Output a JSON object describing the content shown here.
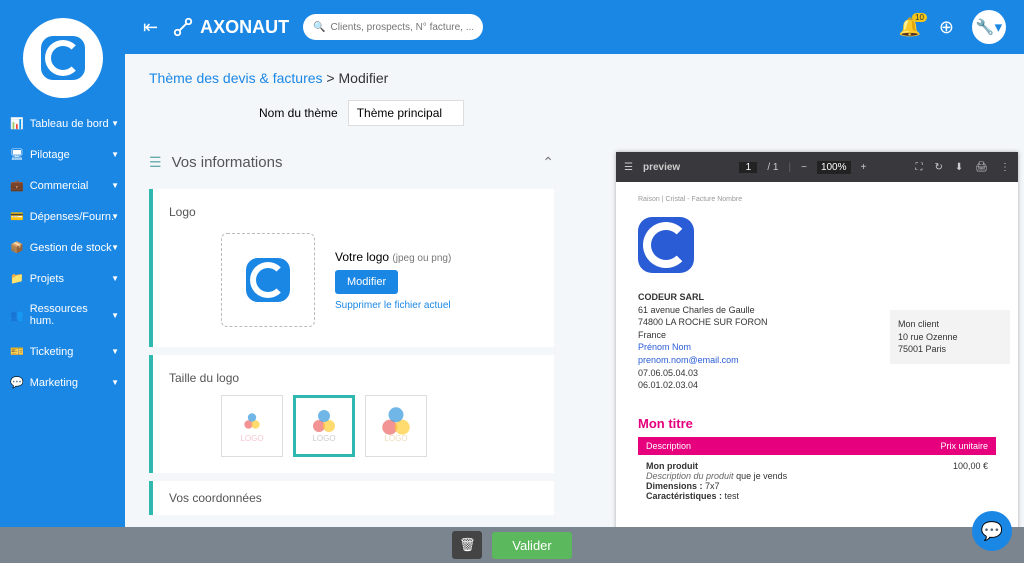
{
  "app": {
    "name": "AXONAUT"
  },
  "search": {
    "placeholder": "Clients, prospects, N° facture, ..."
  },
  "notifications": {
    "count": "10"
  },
  "sidebar": {
    "items": [
      {
        "icon": "📊",
        "label": "Tableau de bord"
      },
      {
        "icon": "🖥",
        "label": "Pilotage"
      },
      {
        "icon": "💼",
        "label": "Commercial"
      },
      {
        "icon": "💳",
        "label": "Dépenses/Fourn."
      },
      {
        "icon": "📦",
        "label": "Gestion de stock"
      },
      {
        "icon": "📁",
        "label": "Projets"
      },
      {
        "icon": "👥",
        "label": "Ressources hum."
      },
      {
        "icon": "🎫",
        "label": "Ticketing"
      },
      {
        "icon": "💬",
        "label": "Marketing"
      }
    ],
    "footer_icon": "✎"
  },
  "breadcrumb": {
    "link": "Thème des devis & factures",
    "sep": " > ",
    "current": "Modifier"
  },
  "theme_name": {
    "label": "Nom du thème",
    "value": "Thème principal"
  },
  "info_section": {
    "title": "Vos informations"
  },
  "logo_block": {
    "title": "Logo",
    "label": "Votre logo",
    "hint": "(jpeg ou png)",
    "modify": "Modifier",
    "delete": "Supprimer le fichier actuel"
  },
  "size_block": {
    "title": "Taille du logo",
    "opt_label": "LOGO"
  },
  "coords_block": {
    "title": "Vos coordonnées"
  },
  "actions": {
    "validate": "Valider"
  },
  "preview": {
    "label": "preview",
    "page_current": "1",
    "page_total": "/  1",
    "zoom": "100%",
    "doc_head": "Raison | Cristal - Facture Nombre",
    "company": {
      "name": "CODEUR SARL",
      "addr1": "61 avenue Charles de Gaulle",
      "addr2": "74800 LA ROCHE SUR FORON",
      "country": "France",
      "contact": "Prénom Nom",
      "email": "prenom.nom@email.com",
      "phone": "07.06.05.04.03",
      "fax": "06.01.02.03.04"
    },
    "client": {
      "name": "Mon client",
      "addr": "10 rue Ozenne",
      "city": "75001 Paris"
    },
    "title": "Mon titre",
    "table": {
      "col1": "Description",
      "col2": "Prix unitaire"
    },
    "row": {
      "name": "Mon produit",
      "desc_label": "Description du produit",
      "desc_rest": " que je vends",
      "dim_label": "Dimensions :",
      "dim_val": " 7x7",
      "car_label": "Caractéristiques :",
      "car_val": " test",
      "price": "100,00 €"
    }
  }
}
